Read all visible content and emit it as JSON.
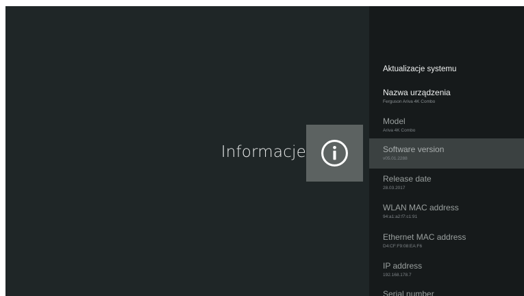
{
  "left": {
    "title": "Informacje",
    "icon": "info-icon"
  },
  "menu": {
    "items": [
      {
        "label": "Aktualizacje systemu",
        "value": ""
      },
      {
        "label": "Nazwa urządzenia",
        "value": "Ferguson Ariva 4K Combo"
      },
      {
        "label": "Model",
        "value": "Ariva 4K Combo"
      },
      {
        "label": "Software version",
        "value": "v05.01.2288"
      },
      {
        "label": "Release date",
        "value": "28.03.2017"
      },
      {
        "label": "WLAN MAC address",
        "value": "94:a1:a2:f7:c1:91"
      },
      {
        "label": "Ethernet MAC address",
        "value": "D4:CF:F9:08:EA:F6"
      },
      {
        "label": "IP address",
        "value": "192.168.178.7"
      },
      {
        "label": "Serial number",
        "value": ""
      }
    ],
    "selected_index": 3
  },
  "colors": {
    "background": "#1f2627",
    "panel": "#161a1b",
    "selected": "#3b4141",
    "icon_tile": "#5c6261"
  }
}
